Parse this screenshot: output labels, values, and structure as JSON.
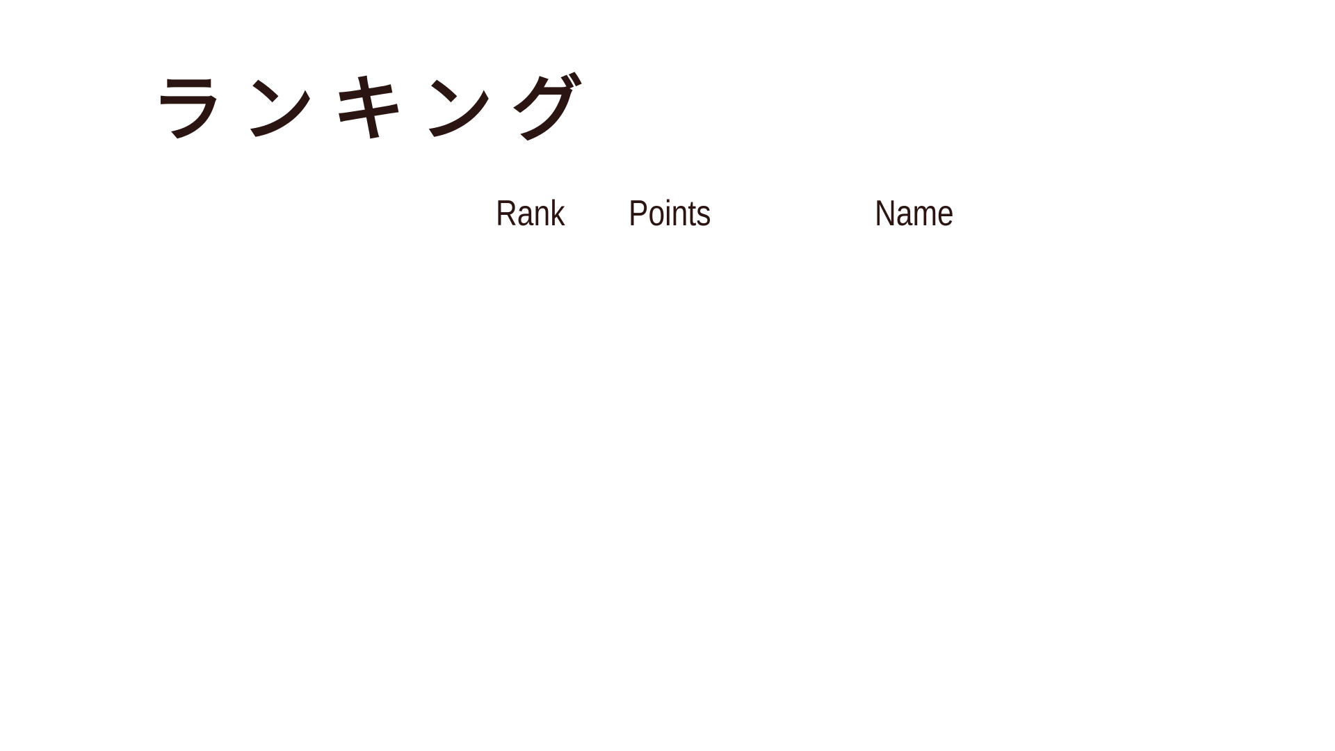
{
  "screen": {
    "title": "ランキング"
  },
  "table": {
    "columns": {
      "rank": "Rank",
      "points": "Points",
      "name": "Name"
    },
    "rows": []
  },
  "colors": {
    "background": "#ffffff",
    "text": "#2b1512"
  }
}
